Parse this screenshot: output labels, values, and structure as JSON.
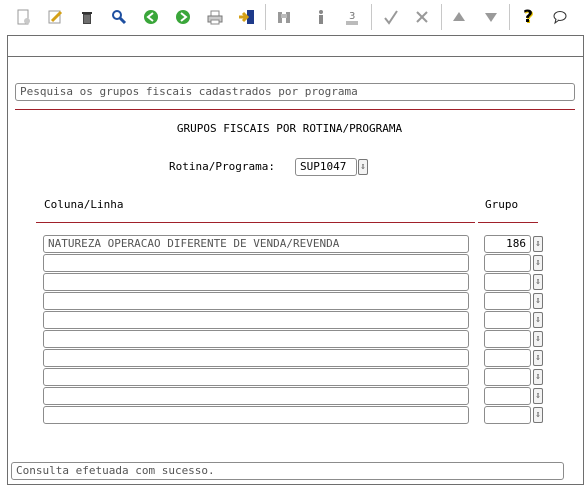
{
  "toolbar": {
    "buttons": [
      {
        "name": "new-icon"
      },
      {
        "name": "edit-icon"
      },
      {
        "name": "trash-icon"
      },
      {
        "name": "search-icon"
      },
      {
        "name": "back-icon"
      },
      {
        "name": "forward-icon"
      },
      {
        "name": "print-icon"
      },
      {
        "name": "exit-icon"
      },
      {
        "name": "binoculars-icon"
      },
      {
        "name": "info-icon"
      },
      {
        "name": "list-icon"
      },
      {
        "name": "check-icon"
      },
      {
        "name": "cancel-icon"
      },
      {
        "name": "up-icon"
      },
      {
        "name": "down-icon"
      },
      {
        "name": "help-icon"
      },
      {
        "name": "comment-icon"
      }
    ],
    "help_glyph": "?"
  },
  "search_bar": {
    "text": "Pesquisa os grupos fiscais cadastrados por programa"
  },
  "title": "GRUPOS FISCAIS POR ROTINA/PROGRAMA",
  "rotina": {
    "label": "Rotina/Programa:",
    "value": "SUP1047"
  },
  "columns": {
    "coluna_linha": "Coluna/Linha",
    "grupo": "Grupo"
  },
  "rows": [
    {
      "coluna_linha": "NATUREZA OPERACAO DIFERENTE DE VENDA/REVENDA",
      "grupo": "186"
    },
    {
      "coluna_linha": "",
      "grupo": ""
    },
    {
      "coluna_linha": "",
      "grupo": ""
    },
    {
      "coluna_linha": "",
      "grupo": ""
    },
    {
      "coluna_linha": "",
      "grupo": ""
    },
    {
      "coluna_linha": "",
      "grupo": ""
    },
    {
      "coluna_linha": "",
      "grupo": ""
    },
    {
      "coluna_linha": "",
      "grupo": ""
    },
    {
      "coluna_linha": "",
      "grupo": ""
    },
    {
      "coluna_linha": "",
      "grupo": ""
    }
  ],
  "status": {
    "text": "Consulta efetuada com sucesso."
  }
}
